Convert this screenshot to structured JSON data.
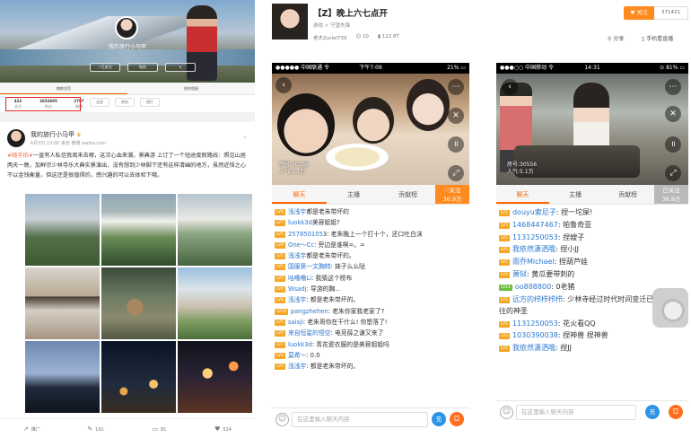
{
  "weibo": {
    "cover_name": "我的旅行小马甲",
    "btn_follow": "✓已关注",
    "btn_msg": "私信",
    "tabs": [
      "他的主页",
      "他的相册"
    ],
    "stats": [
      {
        "n": "423",
        "l": "关注"
      },
      {
        "n": "2652695",
        "l": "粉丝"
      },
      {
        "n": "2797",
        "l": "微博"
      }
    ],
    "subtabs": [
      "全部",
      "原创",
      "图片"
    ],
    "post": {
      "user": "我的旅行小马甲",
      "meta": "6月3日 13:00 来自 微博 weibo.com",
      "tag": "#随手拍#",
      "text": "一直有人私信我周末去哪，这次心血来潮，景典游 上订了一个短途度假路线：照见山居两天一晚，加鲜宗少林寺乐大典实景演出，没有想到少林脚下还有这样清幽的地方，虽然近悟之心不以金钱衡量，但这还是很值得的，感兴趣的可以去体验下哦。"
    },
    "footer": [
      {
        "icon": "↗",
        "label": "推广"
      },
      {
        "icon": "✎",
        "label": "191"
      },
      {
        "icon": "▭",
        "label": "81"
      },
      {
        "icon": "♥",
        "label": "524"
      }
    ]
  },
  "stream": {
    "title": "【Z】晚上六七点开",
    "sub": "游戏 > 守望先锋",
    "host": "老夫Zuriel739",
    "viewers": "10",
    "fans": "122.8T",
    "follow": "关注",
    "follow_count": "371421",
    "share": "分享",
    "watch": "手机看直播"
  },
  "phoneA": {
    "status_left": "●●●●● 中国联通 令",
    "status_center": "下午7:09",
    "status_right": "21% ▭",
    "room": "房号:30556",
    "people": "人气:5.1万",
    "tabs": [
      "聊天",
      "主播",
      "贡献榜"
    ],
    "follow_tab": "♡关注",
    "follow_tab_n": "36.9万",
    "messages": [
      {
        "lv": "LV8",
        "user": "浅浅宇",
        "text": "都是老朱带坏的"
      },
      {
        "lv": "LV7",
        "user": "luokk3d",
        "text": "美蓉姐姐?"
      },
      {
        "lv": "LV5",
        "user": "257850105",
        "text": "3: 老朱晚上一个打十个，还口吐白沫"
      },
      {
        "lv": "LV8",
        "user": "One～Cc",
        "text": ": 旁边是谁啊=。="
      },
      {
        "lv": "LV5",
        "user": "浅浅宇",
        "text": "都是老朱带坏的。"
      },
      {
        "lv": "LV5",
        "user": "国服第一文胸特",
        "text": ": 妹子么么哒"
      },
      {
        "lv": "LV5",
        "user": "咕噜噜Li",
        "text": ": 我猜这个榜布"
      },
      {
        "lv": "LV4",
        "user": "Wsadj",
        "text": ": 导游的胸..."
      },
      {
        "lv": "LV8",
        "user": "浅浅宇",
        "text": ": 都是老朱带坏的。"
      },
      {
        "lv": "LV14",
        "user": "pangzhehen",
        "text": ": 老朱你家我老家了?"
      },
      {
        "lv": "LV5",
        "user": "saisji",
        "text": ": 老朱哥你在干什么! 你堕落了!"
      },
      {
        "lv": "LV4",
        "user": "来自恒星的悟空",
        "text": ": 电竞薛之谦又来了"
      },
      {
        "lv": "LV7",
        "user": "luokk3d",
        "text": ": 青花瓷衣服的是美蓉姐姐吗"
      },
      {
        "lv": "LV4",
        "user": "莫希～",
        "text": ": 0.0"
      },
      {
        "lv": "LV5",
        "user": "浅浅宇",
        "text": ": 都是老朱带坏的。"
      }
    ],
    "input_placeholder": "在这里输入聊天内容",
    "charge": "充",
    "gift": "⛋"
  },
  "phoneB": {
    "status_left": "●●●○○ 中国移动 令",
    "status_center": "14:31",
    "status_right": "⊙ 81% ▭",
    "room": "房号:30556",
    "people": "人气:5.1万",
    "tabs": [
      "聊天",
      "主播",
      "贡献榜"
    ],
    "follow_tab": "已关注",
    "follow_tab_n": "36.9万",
    "messages": [
      {
        "lv": "LV5",
        "user": "douyu索尼子",
        "text": ": 捏一坨屎!"
      },
      {
        "lv": "LV5",
        "user": "1468447467",
        "text": ": 帕鲁奇亚"
      },
      {
        "lv": "LV5",
        "user": "1131250053",
        "text": ": 捏嫂子"
      },
      {
        "lv": "LV5",
        "user": "我依然潇洒哦",
        "text": ": 捏小JJ"
      },
      {
        "lv": "LV5",
        "user": "雨乔Michael",
        "text": ": 捏葫芦娃"
      },
      {
        "lv": "LV5",
        "user": "萧狱",
        "text": ": 黄瓜要带刺的"
      },
      {
        "lv": "LV14",
        "user": "oo888800",
        "text": ": 0老猪",
        "green": true
      },
      {
        "lv": "LV5",
        "user": "远方的栉栉栉栉",
        "text": ": 少林寺经过时代时间变迁已然失去以往的神圣"
      },
      {
        "lv": "LV5",
        "user": "1131250053",
        "text": ": 花火看QQ"
      },
      {
        "lv": "LV5",
        "user": "1030390038",
        "text": ": 捏神兽 捏神兽"
      },
      {
        "lv": "LV5",
        "user": "我依然潇洒哦",
        "text": ": 捏JJ"
      }
    ],
    "input_placeholder": "在这里输入聊天内容",
    "charge": "充",
    "gift": "⛋"
  }
}
